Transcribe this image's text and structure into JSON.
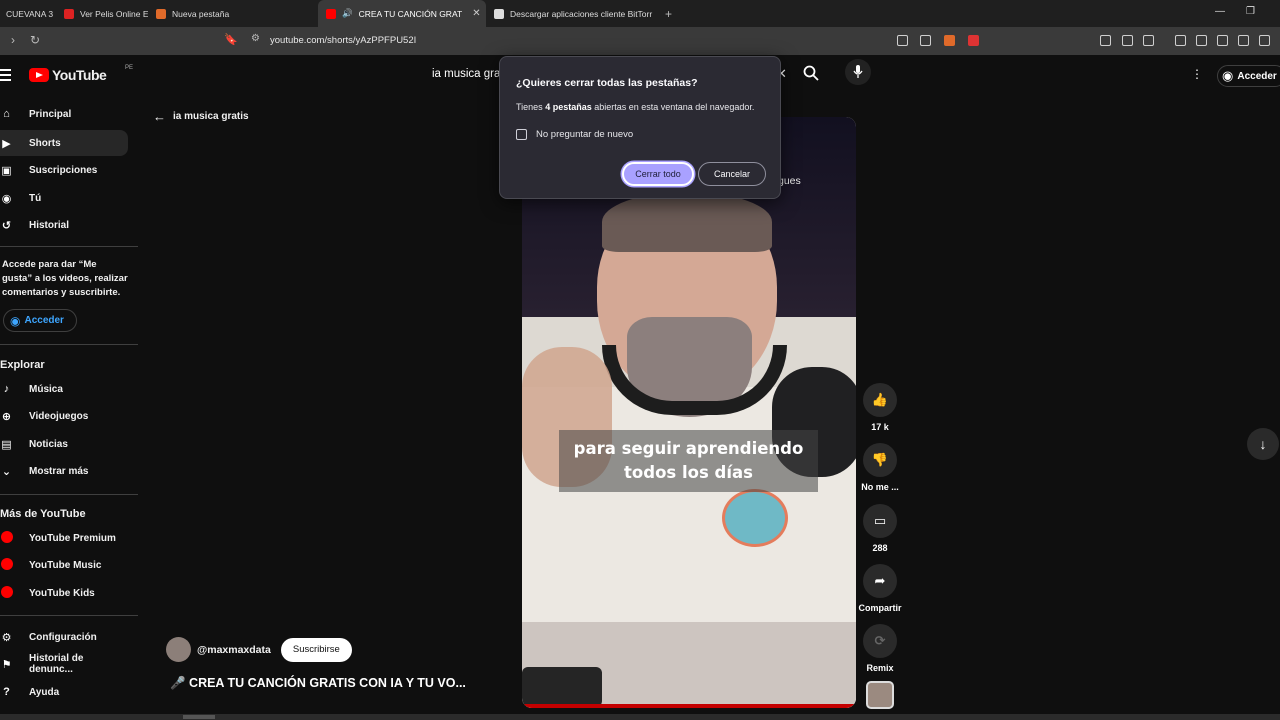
{
  "browser": {
    "tabs": [
      {
        "label": "CUEVANA 3",
        "color": "#e8b000"
      },
      {
        "label": "Ver Pelis Online Estr",
        "color": "#d22"
      },
      {
        "label": "Nueva pestaña",
        "color": "#e06a2a"
      },
      {
        "label": "CREA TU CANCIÓN GRAT",
        "color": "#ff0000"
      },
      {
        "label": "Descargar aplicaciones cliente BitTorr",
        "color": "#ddd"
      }
    ],
    "url": "youtube.com/shorts/yAzPPFPU52I"
  },
  "header": {
    "logo_text": "YouTube",
    "region": "PE",
    "search_query": "ia musica gratis",
    "signin_label": "Acceder"
  },
  "sidebar": {
    "items": [
      {
        "label": "Principal",
        "icon": "home-icon"
      },
      {
        "label": "Shorts",
        "icon": "shorts-icon"
      },
      {
        "label": "Suscripciones",
        "icon": "subscriptions-icon"
      },
      {
        "label": "Tú",
        "icon": "user-icon"
      },
      {
        "label": "Historial",
        "icon": "history-icon"
      }
    ],
    "signin_note": "Accede para dar “Me gusta” a los videos, realizar comentarios y suscribirte.",
    "signin_button": "Acceder",
    "explore_heading": "Explorar",
    "explore": [
      {
        "label": "Música",
        "icon": "music-icon"
      },
      {
        "label": "Videojuegos",
        "icon": "gamepad-icon"
      },
      {
        "label": "Noticias",
        "icon": "news-icon"
      },
      {
        "label": "Mostrar más",
        "icon": "chevron-down-icon"
      }
    ],
    "more_heading": "Más de YouTube",
    "more": [
      {
        "label": "YouTube Premium"
      },
      {
        "label": "YouTube Music"
      },
      {
        "label": "YouTube Kids"
      }
    ],
    "footer": [
      {
        "label": "Configuración",
        "icon": "gear-icon"
      },
      {
        "label": "Historial de denunc...",
        "icon": "flag-icon"
      },
      {
        "label": "Ayuda",
        "icon": "help-icon"
      }
    ]
  },
  "main": {
    "back_label": "ia musica gratis",
    "subtitle_line1": "para seguir aprendiendo",
    "subtitle_line2": "todos los días",
    "partial_text": "gues",
    "channel": "@maxmaxdata",
    "subscribe": "Suscribirse",
    "video_title": "🎤 CREA TU CANCIÓN GRATIS CON IA Y TU VO...",
    "actions": {
      "likes": "17 k",
      "dislike": "No me ...",
      "comments": "288",
      "share": "Compartir",
      "remix": "Remix"
    }
  },
  "dialog": {
    "title": "¿Quieres cerrar todas las pestañas?",
    "msg_pre": "Tienes ",
    "msg_count": "4 pestañas",
    "msg_post": " abiertas en esta ventana del navegador.",
    "checkbox_label": "No preguntar de nuevo",
    "confirm": "Cerrar todo",
    "cancel": "Cancelar"
  }
}
